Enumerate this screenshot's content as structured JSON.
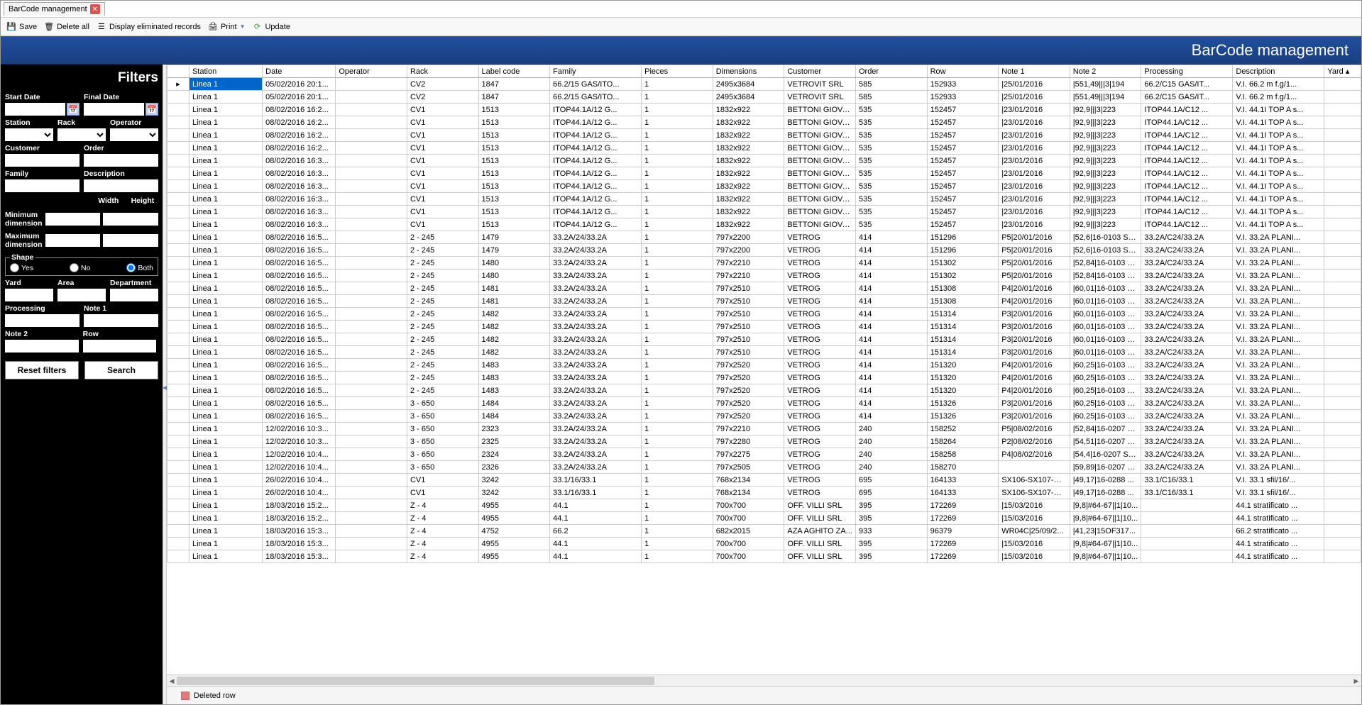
{
  "tab": {
    "title": "BarCode management"
  },
  "toolbar": {
    "save": "Save",
    "delete_all": "Delete all",
    "display_eliminated": "Display eliminated records",
    "print": "Print",
    "update": "Update"
  },
  "banner": "BarCode management",
  "filters": {
    "title": "Filters",
    "start_date": "Start Date",
    "final_date": "Final Date",
    "station": "Station",
    "rack": "Rack",
    "operator": "Operator",
    "customer": "Customer",
    "order": "Order",
    "family": "Family",
    "description": "Description",
    "width": "Width",
    "height": "Height",
    "min_dim": "Minimum dimension",
    "max_dim": "Maximum dimension",
    "shape": "Shape",
    "yes": "Yes",
    "no": "No",
    "both": "Both",
    "yard": "Yard",
    "area": "Area",
    "department": "Department",
    "processing": "Processing",
    "note1": "Note 1",
    "note2": "Note 2",
    "row": "Row",
    "reset": "Reset filters",
    "search": "Search"
  },
  "columns": [
    "Station",
    "Date",
    "Operator",
    "Rack",
    "Label code",
    "Family",
    "Pieces",
    "Dimensions",
    "Customer",
    "Order",
    "Row",
    "Note 1",
    "Note 2",
    "Processing",
    "Description",
    "Yard"
  ],
  "rows": [
    {
      "station": "Linea 1",
      "date": "05/02/2016 20:1...",
      "op": "",
      "rack": "CV2",
      "code": "1847",
      "family": "66.2/15 GAS/ITO...",
      "pieces": "1",
      "dim": "2495x3684",
      "cust": "VETROVIT SRL",
      "order": "585",
      "row": "152933",
      "n1": "|25/01/2016",
      "n2": "|551,49|||3|194",
      "proc": "66.2/C15 GAS/IT...",
      "desc": "V.I. 66.2 m f.g/1..."
    },
    {
      "station": "Linea 1",
      "date": "05/02/2016 20:1...",
      "op": "",
      "rack": "CV2",
      "code": "1847",
      "family": "66.2/15 GAS/ITO...",
      "pieces": "1",
      "dim": "2495x3684",
      "cust": "VETROVIT SRL",
      "order": "585",
      "row": "152933",
      "n1": "|25/01/2016",
      "n2": "|551,49|||3|194",
      "proc": "66.2/C15 GAS/IT...",
      "desc": "V.I. 66.2 m f.g/1..."
    },
    {
      "station": "Linea 1",
      "date": "08/02/2016 16:2...",
      "op": "",
      "rack": "CV1",
      "code": "1513",
      "family": "ITOP44.1A/12 G...",
      "pieces": "1",
      "dim": "1832x922",
      "cust": "BETTONI GIOVA...",
      "order": "535",
      "row": "152457",
      "n1": "|23/01/2016",
      "n2": "|92,9|||3|223",
      "proc": "ITOP44.1A/C12 ...",
      "desc": "V.I. 44.1I TOP A s..."
    },
    {
      "station": "Linea 1",
      "date": "08/02/2016 16:2...",
      "op": "",
      "rack": "CV1",
      "code": "1513",
      "family": "ITOP44.1A/12 G...",
      "pieces": "1",
      "dim": "1832x922",
      "cust": "BETTONI GIOVA...",
      "order": "535",
      "row": "152457",
      "n1": "|23/01/2016",
      "n2": "|92,9|||3|223",
      "proc": "ITOP44.1A/C12 ...",
      "desc": "V.I. 44.1I TOP A s..."
    },
    {
      "station": "Linea 1",
      "date": "08/02/2016 16:2...",
      "op": "",
      "rack": "CV1",
      "code": "1513",
      "family": "ITOP44.1A/12 G...",
      "pieces": "1",
      "dim": "1832x922",
      "cust": "BETTONI GIOVA...",
      "order": "535",
      "row": "152457",
      "n1": "|23/01/2016",
      "n2": "|92,9|||3|223",
      "proc": "ITOP44.1A/C12 ...",
      "desc": "V.I. 44.1I TOP A s..."
    },
    {
      "station": "Linea 1",
      "date": "08/02/2016 16:2...",
      "op": "",
      "rack": "CV1",
      "code": "1513",
      "family": "ITOP44.1A/12 G...",
      "pieces": "1",
      "dim": "1832x922",
      "cust": "BETTONI GIOVA...",
      "order": "535",
      "row": "152457",
      "n1": "|23/01/2016",
      "n2": "|92,9|||3|223",
      "proc": "ITOP44.1A/C12 ...",
      "desc": "V.I. 44.1I TOP A s..."
    },
    {
      "station": "Linea 1",
      "date": "08/02/2016 16:3...",
      "op": "",
      "rack": "CV1",
      "code": "1513",
      "family": "ITOP44.1A/12 G...",
      "pieces": "1",
      "dim": "1832x922",
      "cust": "BETTONI GIOVA...",
      "order": "535",
      "row": "152457",
      "n1": "|23/01/2016",
      "n2": "|92,9|||3|223",
      "proc": "ITOP44.1A/C12 ...",
      "desc": "V.I. 44.1I TOP A s..."
    },
    {
      "station": "Linea 1",
      "date": "08/02/2016 16:3...",
      "op": "",
      "rack": "CV1",
      "code": "1513",
      "family": "ITOP44.1A/12 G...",
      "pieces": "1",
      "dim": "1832x922",
      "cust": "BETTONI GIOVA...",
      "order": "535",
      "row": "152457",
      "n1": "|23/01/2016",
      "n2": "|92,9|||3|223",
      "proc": "ITOP44.1A/C12 ...",
      "desc": "V.I. 44.1I TOP A s..."
    },
    {
      "station": "Linea 1",
      "date": "08/02/2016 16:3...",
      "op": "",
      "rack": "CV1",
      "code": "1513",
      "family": "ITOP44.1A/12 G...",
      "pieces": "1",
      "dim": "1832x922",
      "cust": "BETTONI GIOVA...",
      "order": "535",
      "row": "152457",
      "n1": "|23/01/2016",
      "n2": "|92,9|||3|223",
      "proc": "ITOP44.1A/C12 ...",
      "desc": "V.I. 44.1I TOP A s..."
    },
    {
      "station": "Linea 1",
      "date": "08/02/2016 16:3...",
      "op": "",
      "rack": "CV1",
      "code": "1513",
      "family": "ITOP44.1A/12 G...",
      "pieces": "1",
      "dim": "1832x922",
      "cust": "BETTONI GIOVA...",
      "order": "535",
      "row": "152457",
      "n1": "|23/01/2016",
      "n2": "|92,9|||3|223",
      "proc": "ITOP44.1A/C12 ...",
      "desc": "V.I. 44.1I TOP A s..."
    },
    {
      "station": "Linea 1",
      "date": "08/02/2016 16:3...",
      "op": "",
      "rack": "CV1",
      "code": "1513",
      "family": "ITOP44.1A/12 G...",
      "pieces": "1",
      "dim": "1832x922",
      "cust": "BETTONI GIOVA...",
      "order": "535",
      "row": "152457",
      "n1": "|23/01/2016",
      "n2": "|92,9|||3|223",
      "proc": "ITOP44.1A/C12 ...",
      "desc": "V.I. 44.1I TOP A s..."
    },
    {
      "station": "Linea 1",
      "date": "08/02/2016 16:3...",
      "op": "",
      "rack": "CV1",
      "code": "1513",
      "family": "ITOP44.1A/12 G...",
      "pieces": "1",
      "dim": "1832x922",
      "cust": "BETTONI GIOVA...",
      "order": "535",
      "row": "152457",
      "n1": "|23/01/2016",
      "n2": "|92,9|||3|223",
      "proc": "ITOP44.1A/C12 ...",
      "desc": "V.I. 44.1I TOP A s..."
    },
    {
      "station": "Linea 1",
      "date": "08/02/2016 16:5...",
      "op": "",
      "rack": "2 - 245",
      "code": "1479",
      "family": "33.2A/24/33.2A",
      "pieces": "1",
      "dim": "797x2200",
      "cust": "VETROG",
      "order": "414",
      "row": "151296",
      "n1": "P5|20/01/2016",
      "n2": "|52,6|16-0103 SE...",
      "proc": "33.2A/C24/33.2A",
      "desc": "V.I. 33.2A PLANI..."
    },
    {
      "station": "Linea 1",
      "date": "08/02/2016 16:5...",
      "op": "",
      "rack": "2 - 245",
      "code": "1479",
      "family": "33.2A/24/33.2A",
      "pieces": "1",
      "dim": "797x2200",
      "cust": "VETROG",
      "order": "414",
      "row": "151296",
      "n1": "P5|20/01/2016",
      "n2": "|52,6|16-0103 SE...",
      "proc": "33.2A/C24/33.2A",
      "desc": "V.I. 33.2A PLANI..."
    },
    {
      "station": "Linea 1",
      "date": "08/02/2016 16:5...",
      "op": "",
      "rack": "2 - 245",
      "code": "1480",
      "family": "33.2A/24/33.2A",
      "pieces": "1",
      "dim": "797x2210",
      "cust": "VETROG",
      "order": "414",
      "row": "151302",
      "n1": "P5|20/01/2016",
      "n2": "|52,84|16-0103 S...",
      "proc": "33.2A/C24/33.2A",
      "desc": "V.I. 33.2A PLANI..."
    },
    {
      "station": "Linea 1",
      "date": "08/02/2016 16:5...",
      "op": "",
      "rack": "2 - 245",
      "code": "1480",
      "family": "33.2A/24/33.2A",
      "pieces": "1",
      "dim": "797x2210",
      "cust": "VETROG",
      "order": "414",
      "row": "151302",
      "n1": "P5|20/01/2016",
      "n2": "|52,84|16-0103 S...",
      "proc": "33.2A/C24/33.2A",
      "desc": "V.I. 33.2A PLANI..."
    },
    {
      "station": "Linea 1",
      "date": "08/02/2016 16:5...",
      "op": "",
      "rack": "2 - 245",
      "code": "1481",
      "family": "33.2A/24/33.2A",
      "pieces": "1",
      "dim": "797x2510",
      "cust": "VETROG",
      "order": "414",
      "row": "151308",
      "n1": "P4|20/01/2016",
      "n2": "|60,01|16-0103 S...",
      "proc": "33.2A/C24/33.2A",
      "desc": "V.I. 33.2A PLANI..."
    },
    {
      "station": "Linea 1",
      "date": "08/02/2016 16:5...",
      "op": "",
      "rack": "2 - 245",
      "code": "1481",
      "family": "33.2A/24/33.2A",
      "pieces": "1",
      "dim": "797x2510",
      "cust": "VETROG",
      "order": "414",
      "row": "151308",
      "n1": "P4|20/01/2016",
      "n2": "|60,01|16-0103 S...",
      "proc": "33.2A/C24/33.2A",
      "desc": "V.I. 33.2A PLANI..."
    },
    {
      "station": "Linea 1",
      "date": "08/02/2016 16:5...",
      "op": "",
      "rack": "2 - 245",
      "code": "1482",
      "family": "33.2A/24/33.2A",
      "pieces": "1",
      "dim": "797x2510",
      "cust": "VETROG",
      "order": "414",
      "row": "151314",
      "n1": "P3|20/01/2016",
      "n2": "|60,01|16-0103 S...",
      "proc": "33.2A/C24/33.2A",
      "desc": "V.I. 33.2A PLANI..."
    },
    {
      "station": "Linea 1",
      "date": "08/02/2016 16:5...",
      "op": "",
      "rack": "2 - 245",
      "code": "1482",
      "family": "33.2A/24/33.2A",
      "pieces": "1",
      "dim": "797x2510",
      "cust": "VETROG",
      "order": "414",
      "row": "151314",
      "n1": "P3|20/01/2016",
      "n2": "|60,01|16-0103 S...",
      "proc": "33.2A/C24/33.2A",
      "desc": "V.I. 33.2A PLANI..."
    },
    {
      "station": "Linea 1",
      "date": "08/02/2016 16:5...",
      "op": "",
      "rack": "2 - 245",
      "code": "1482",
      "family": "33.2A/24/33.2A",
      "pieces": "1",
      "dim": "797x2510",
      "cust": "VETROG",
      "order": "414",
      "row": "151314",
      "n1": "P3|20/01/2016",
      "n2": "|60,01|16-0103 S...",
      "proc": "33.2A/C24/33.2A",
      "desc": "V.I. 33.2A PLANI..."
    },
    {
      "station": "Linea 1",
      "date": "08/02/2016 16:5...",
      "op": "",
      "rack": "2 - 245",
      "code": "1482",
      "family": "33.2A/24/33.2A",
      "pieces": "1",
      "dim": "797x2510",
      "cust": "VETROG",
      "order": "414",
      "row": "151314",
      "n1": "P3|20/01/2016",
      "n2": "|60,01|16-0103 S...",
      "proc": "33.2A/C24/33.2A",
      "desc": "V.I. 33.2A PLANI..."
    },
    {
      "station": "Linea 1",
      "date": "08/02/2016 16:5...",
      "op": "",
      "rack": "2 - 245",
      "code": "1483",
      "family": "33.2A/24/33.2A",
      "pieces": "1",
      "dim": "797x2520",
      "cust": "VETROG",
      "order": "414",
      "row": "151320",
      "n1": "P4|20/01/2016",
      "n2": "|60,25|16-0103 S...",
      "proc": "33.2A/C24/33.2A",
      "desc": "V.I. 33.2A PLANI..."
    },
    {
      "station": "Linea 1",
      "date": "08/02/2016 16:5...",
      "op": "",
      "rack": "2 - 245",
      "code": "1483",
      "family": "33.2A/24/33.2A",
      "pieces": "1",
      "dim": "797x2520",
      "cust": "VETROG",
      "order": "414",
      "row": "151320",
      "n1": "P4|20/01/2016",
      "n2": "|60,25|16-0103 S...",
      "proc": "33.2A/C24/33.2A",
      "desc": "V.I. 33.2A PLANI..."
    },
    {
      "station": "Linea 1",
      "date": "08/02/2016 16:5...",
      "op": "",
      "rack": "2 - 245",
      "code": "1483",
      "family": "33.2A/24/33.2A",
      "pieces": "1",
      "dim": "797x2520",
      "cust": "VETROG",
      "order": "414",
      "row": "151320",
      "n1": "P4|20/01/2016",
      "n2": "|60,25|16-0103 S...",
      "proc": "33.2A/C24/33.2A",
      "desc": "V.I. 33.2A PLANI..."
    },
    {
      "station": "Linea 1",
      "date": "08/02/2016 16:5...",
      "op": "",
      "rack": "3 - 650",
      "code": "1484",
      "family": "33.2A/24/33.2A",
      "pieces": "1",
      "dim": "797x2520",
      "cust": "VETROG",
      "order": "414",
      "row": "151326",
      "n1": "P3|20/01/2016",
      "n2": "|60,25|16-0103 S...",
      "proc": "33.2A/C24/33.2A",
      "desc": "V.I. 33.2A PLANI..."
    },
    {
      "station": "Linea 1",
      "date": "08/02/2016 16:5...",
      "op": "",
      "rack": "3 - 650",
      "code": "1484",
      "family": "33.2A/24/33.2A",
      "pieces": "1",
      "dim": "797x2520",
      "cust": "VETROG",
      "order": "414",
      "row": "151326",
      "n1": "P3|20/01/2016",
      "n2": "|60,25|16-0103 S...",
      "proc": "33.2A/C24/33.2A",
      "desc": "V.I. 33.2A PLANI..."
    },
    {
      "station": "Linea 1",
      "date": "12/02/2016 10:3...",
      "op": "",
      "rack": "3 - 650",
      "code": "2323",
      "family": "33.2A/24/33.2A",
      "pieces": "1",
      "dim": "797x2210",
      "cust": "VETROG",
      "order": "240",
      "row": "158252",
      "n1": "P5|08/02/2016",
      "n2": "|52,84|16-0207 S...",
      "proc": "33.2A/C24/33.2A",
      "desc": "V.I. 33.2A PLANI..."
    },
    {
      "station": "Linea 1",
      "date": "12/02/2016 10:3...",
      "op": "",
      "rack": "3 - 650",
      "code": "2325",
      "family": "33.2A/24/33.2A",
      "pieces": "1",
      "dim": "797x2280",
      "cust": "VETROG",
      "order": "240",
      "row": "158264",
      "n1": "P2|08/02/2016",
      "n2": "|54,51|16-0207 S...",
      "proc": "33.2A/C24/33.2A",
      "desc": "V.I. 33.2A PLANI..."
    },
    {
      "station": "Linea 1",
      "date": "12/02/2016 10:4...",
      "op": "",
      "rack": "3 - 650",
      "code": "2324",
      "family": "33.2A/24/33.2A",
      "pieces": "1",
      "dim": "797x2275",
      "cust": "VETROG",
      "order": "240",
      "row": "158258",
      "n1": "P4|08/02/2016",
      "n2": "|54,4|16-0207 SE...",
      "proc": "33.2A/C24/33.2A",
      "desc": "V.I. 33.2A PLANI..."
    },
    {
      "station": "Linea 1",
      "date": "12/02/2016 10:4...",
      "op": "",
      "rack": "3 - 650",
      "code": "2326",
      "family": "33.2A/24/33.2A",
      "pieces": "1",
      "dim": "797x2505",
      "cust": "VETROG",
      "order": "240",
      "row": "158270",
      "n1": "",
      "n2": "|59,89|16-0207 S...",
      "proc": "33.2A/C24/33.2A",
      "desc": "V.I. 33.2A PLANI..."
    },
    {
      "station": "Linea 1",
      "date": "26/02/2016 10:4...",
      "op": "",
      "rack": "CV1",
      "code": "3242",
      "family": "33.1/16/33.1",
      "pieces": "1",
      "dim": "768x2134",
      "cust": "VETROG",
      "order": "695",
      "row": "164133",
      "n1": "SX106-SX107-DX...",
      "n2": "|49,17|16-0288 ...",
      "proc": "33.1/C16/33.1",
      "desc": "V.I. 33.1 sfil/16/..."
    },
    {
      "station": "Linea 1",
      "date": "26/02/2016 10:4...",
      "op": "",
      "rack": "CV1",
      "code": "3242",
      "family": "33.1/16/33.1",
      "pieces": "1",
      "dim": "768x2134",
      "cust": "VETROG",
      "order": "695",
      "row": "164133",
      "n1": "SX106-SX107-DX...",
      "n2": "|49,17|16-0288 ...",
      "proc": "33.1/C16/33.1",
      "desc": "V.I. 33.1 sfil/16/..."
    },
    {
      "station": "Linea 1",
      "date": "18/03/2016 15:2...",
      "op": "",
      "rack": "Z - 4",
      "code": "4955",
      "family": "44.1",
      "pieces": "1",
      "dim": "700x700",
      "cust": "OFF. VILLI SRL",
      "order": "395",
      "row": "172269",
      "n1": "|15/03/2016",
      "n2": "|9,8|#64-67||1|10...",
      "proc": "",
      "desc": "44.1 stratificato ..."
    },
    {
      "station": "Linea 1",
      "date": "18/03/2016 15:2...",
      "op": "",
      "rack": "Z - 4",
      "code": "4955",
      "family": "44.1",
      "pieces": "1",
      "dim": "700x700",
      "cust": "OFF. VILLI SRL",
      "order": "395",
      "row": "172269",
      "n1": "|15/03/2016",
      "n2": "|9,8|#64-67||1|10...",
      "proc": "",
      "desc": "44.1 stratificato ..."
    },
    {
      "station": "Linea 1",
      "date": "18/03/2016 15:3...",
      "op": "",
      "rack": "Z - 4",
      "code": "4752",
      "family": "66.2",
      "pieces": "1",
      "dim": "682x2015",
      "cust": "AZA AGHITO ZA...",
      "order": "933",
      "row": "96379",
      "n1": "WR04C|25/09/2...",
      "n2": "|41,23|15OF317...",
      "proc": "",
      "desc": "66.2 stratificato ..."
    },
    {
      "station": "Linea 1",
      "date": "18/03/2016 15:3...",
      "op": "",
      "rack": "Z - 4",
      "code": "4955",
      "family": "44.1",
      "pieces": "1",
      "dim": "700x700",
      "cust": "OFF. VILLI SRL",
      "order": "395",
      "row": "172269",
      "n1": "|15/03/2016",
      "n2": "|9,8|#64-67||1|10...",
      "proc": "",
      "desc": "44.1 stratificato ..."
    },
    {
      "station": "Linea 1",
      "date": "18/03/2016 15:3...",
      "op": "",
      "rack": "Z - 4",
      "code": "4955",
      "family": "44.1",
      "pieces": "1",
      "dim": "700x700",
      "cust": "OFF. VILLI SRL",
      "order": "395",
      "row": "172269",
      "n1": "|15/03/2016",
      "n2": "|9,8|#64-67||1|10...",
      "proc": "",
      "desc": "44.1 stratificato ..."
    }
  ],
  "status": {
    "deleted_row": "Deleted row"
  }
}
